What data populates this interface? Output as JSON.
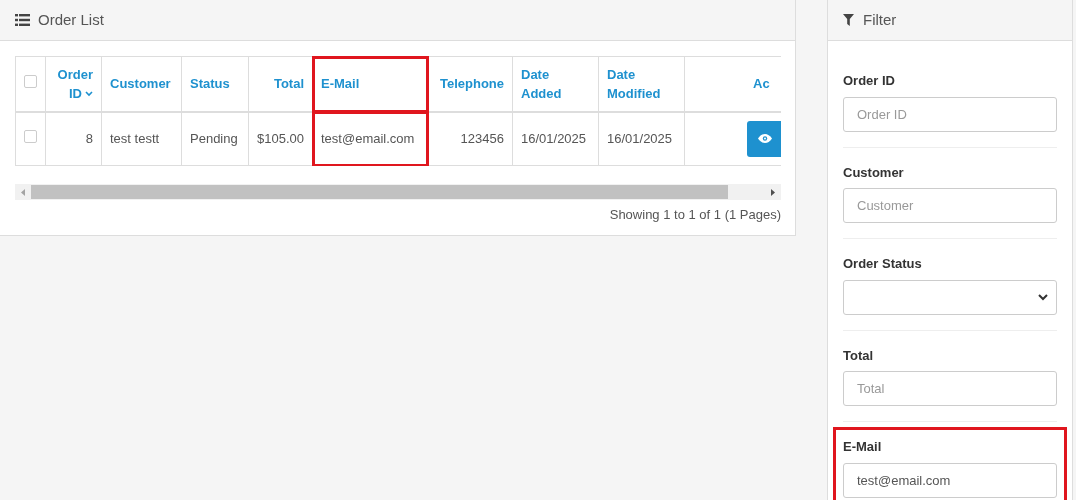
{
  "order_list": {
    "title": "Order List",
    "select_all_checked": false,
    "columns": [
      {
        "label": "Order ID",
        "sorted": true,
        "highlighted": false
      },
      {
        "label": "Customer",
        "sorted": false,
        "highlighted": false
      },
      {
        "label": "Status",
        "sorted": false,
        "highlighted": false
      },
      {
        "label": "Total",
        "sorted": false,
        "highlighted": false
      },
      {
        "label": "E-Mail",
        "sorted": false,
        "highlighted": true
      },
      {
        "label": "Telephone",
        "sorted": false,
        "highlighted": false
      },
      {
        "label": "Date Added",
        "sorted": false,
        "highlighted": false
      },
      {
        "label": "Date Modified",
        "sorted": false,
        "highlighted": false
      },
      {
        "label": "Ac",
        "sorted": false,
        "highlighted": false
      }
    ],
    "rows": [
      {
        "checked": false,
        "cells": [
          "8",
          "test testt",
          "Pending",
          "$105.00",
          "test@email.com",
          "123456",
          "16/01/2025",
          "16/01/2025"
        ]
      }
    ],
    "pagination": "Showing 1 to 1 of 1 (1 Pages)"
  },
  "filter": {
    "title": "Filter",
    "fields": [
      {
        "kind": "input",
        "label": "Order ID",
        "placeholder": "Order ID",
        "highlighted": false
      },
      {
        "kind": "input",
        "label": "Customer",
        "placeholder": "Customer",
        "highlighted": false
      },
      {
        "kind": "select",
        "label": "Order Status",
        "highlighted": false
      },
      {
        "kind": "input",
        "label": "Total",
        "placeholder": "Total",
        "highlighted": false
      },
      {
        "kind": "input",
        "label": "E-Mail",
        "value": "test@email.com",
        "highlighted": true
      }
    ]
  }
}
